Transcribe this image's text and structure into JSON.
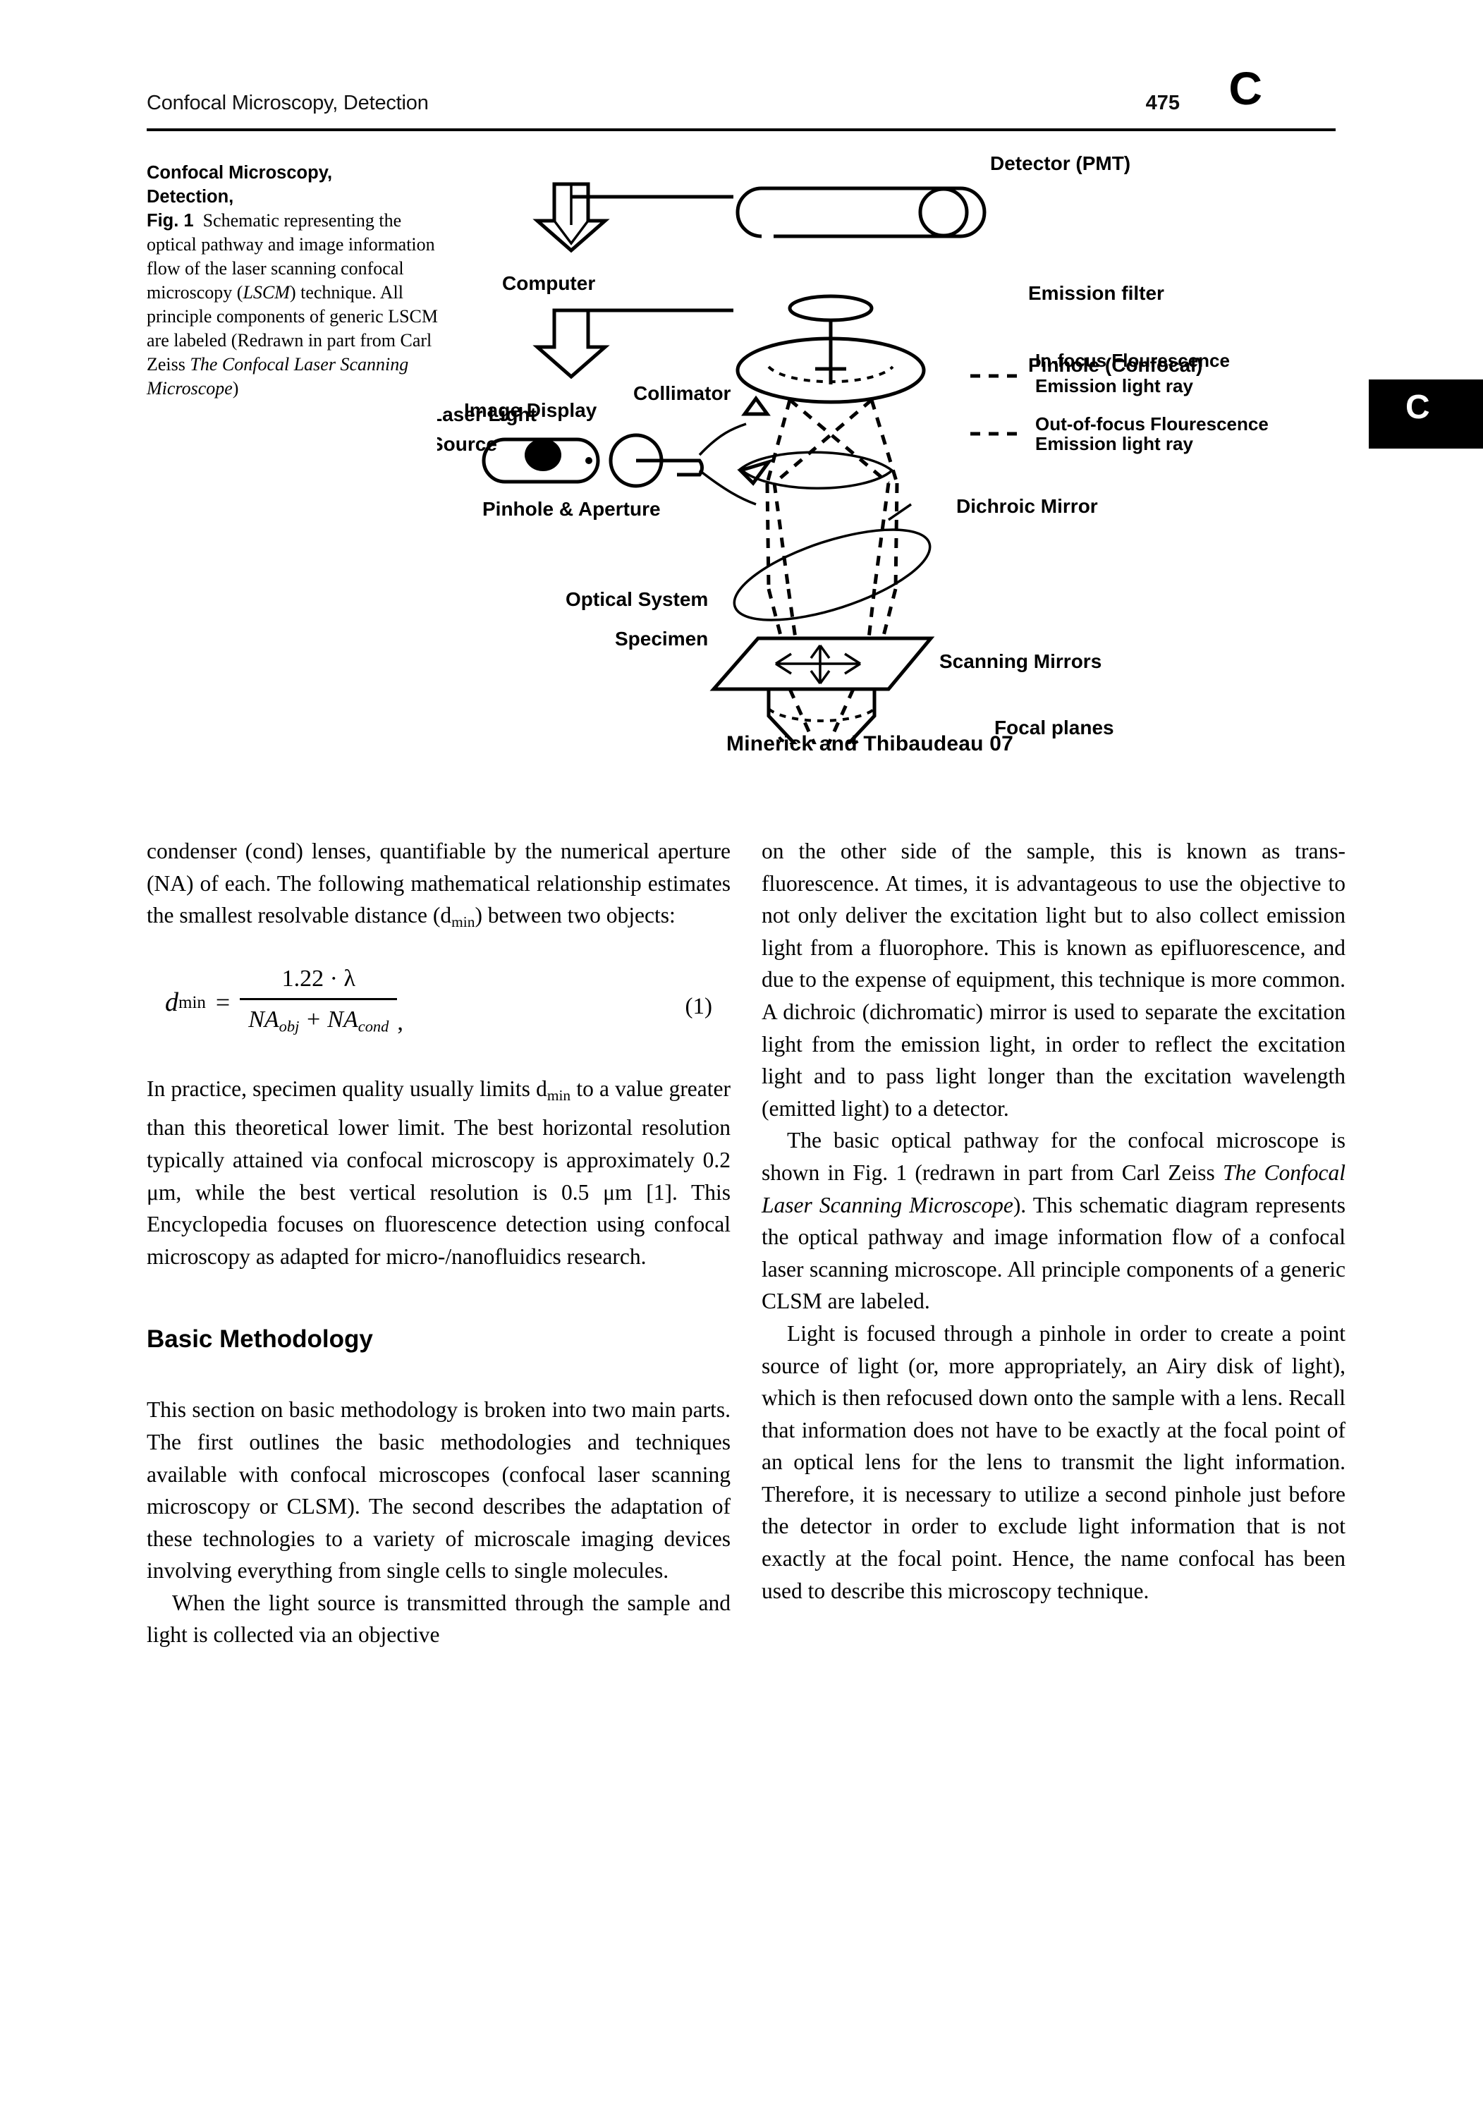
{
  "running_head": {
    "title": "Confocal Microscopy, Detection",
    "page_number": "475",
    "section_letter": "C"
  },
  "thumb_tab": {
    "letter": "C"
  },
  "figure_caption": {
    "entry_title_line1": "Confocal Microscopy,",
    "entry_title_line2": "Detection,",
    "figure_number": "Fig. 1",
    "body_part1": "Schematic representing the optical pathway and image information flow of the laser scanning confocal microscopy (",
    "italic1": "LSCM",
    "body_part2": ") technique. All principle components of generic LSCM are labeled (Redrawn in part from Carl Zeiss ",
    "italic2": "The Confocal Laser Scanning Microscope",
    "body_part3": ")"
  },
  "figure": {
    "credit": "Minerick and Thibaudeau 07",
    "labels": {
      "detector": "Detector (PMT)",
      "emission_filter": "Emission filter",
      "pinhole_confocal": "Pinhole (Confocal)",
      "in_focus_line1": "In-focus Flourescence",
      "in_focus_line2": "Emission light ray",
      "out_focus_line1": "Out-of-focus Flourescence",
      "out_focus_line2": "Emission light ray",
      "dichroic_mirror": "Dichroic Mirror",
      "scanning_mirrors": "Scanning Mirrors",
      "focal_planes": "Focal planes",
      "computer": "Computer",
      "image_display": "Image Display",
      "collimator": "Collimator",
      "laser_line1": "Laser Light",
      "laser_line2": "Source",
      "pinhole_aperture": "Pinhole & Aperture",
      "optical_system": "Optical System",
      "specimen": "Specimen"
    }
  },
  "left_column": {
    "para1_a": "condenser (cond) lenses, quantifiable by the numerical aperture (NA) of each. The following mathematical relationship estimates the smallest resolvable distance (d",
    "para1_sub": "min",
    "para1_b": ") between two objects:",
    "equation": {
      "lhs_symbol": "d",
      "lhs_sub": "min",
      "equals": "=",
      "numerator": "1.22 · λ",
      "denominator_a": "NA",
      "denominator_a_sub": "obj",
      "denominator_plus": "+",
      "denominator_b": "NA",
      "denominator_b_sub": "cond",
      "trailing_comma": ",",
      "number": "(1)"
    },
    "para2_a": "In practice, specimen quality usually limits d",
    "para2_sub": "min",
    "para2_b": " to a value greater than this theoretical lower limit. The best horizontal resolution typically attained via confocal microscopy is approximately 0.2 μm, while the best vertical resolution is 0.5 μm [1]. This Encyclopedia focuses on fluorescence detection using confocal microscopy as adapted for micro-/nanofluidics research.",
    "section_heading": "Basic Methodology",
    "para3": "This section on basic methodology is broken into two main parts. The first outlines the basic methodologies and techniques available with confocal microscopes (confocal laser scanning microscopy or CLSM). The second describes the adaptation of these technologies to a variety of microscale imaging devices involving everything from single cells to single molecules.",
    "para4": "When the light source is transmitted through the sample and light is collected via an objective"
  },
  "right_column": {
    "para1": "on the other side of the sample, this is known as trans-fluorescence. At times, it is advantageous to use the objective to not only deliver the excitation light but to also collect emission light from a fluorophore. This is known as epifluorescence, and due to the expense of equipment, this technique is more common. A dichroic (dichromatic) mirror is used to separate the excitation light from the emission light, in order to reflect the excitation light and to pass light longer than the excitation wavelength (emitted light) to a detector.",
    "para2_a": "The basic optical pathway for the confocal microscope is shown in Fig. 1 (redrawn in part from Carl Zeiss ",
    "para2_italic": "The Confocal Laser Scanning Microscope",
    "para2_b": "). This schematic diagram represents the optical pathway and image information flow of a confocal laser scanning microscope. All principle components of a generic CLSM are labeled.",
    "para3": "Light is focused through a pinhole in order to create a point source of light (or, more appropriately, an Airy disk of light), which is then refocused down onto the sample with a lens. Recall that information does not have to be exactly at the focal point of an optical lens for the lens to transmit the light information. Therefore, it is necessary to utilize a second pinhole just before the detector in order to exclude light information that is not exactly at the focal point. Hence, the name confocal has been used to describe this microscopy technique."
  }
}
